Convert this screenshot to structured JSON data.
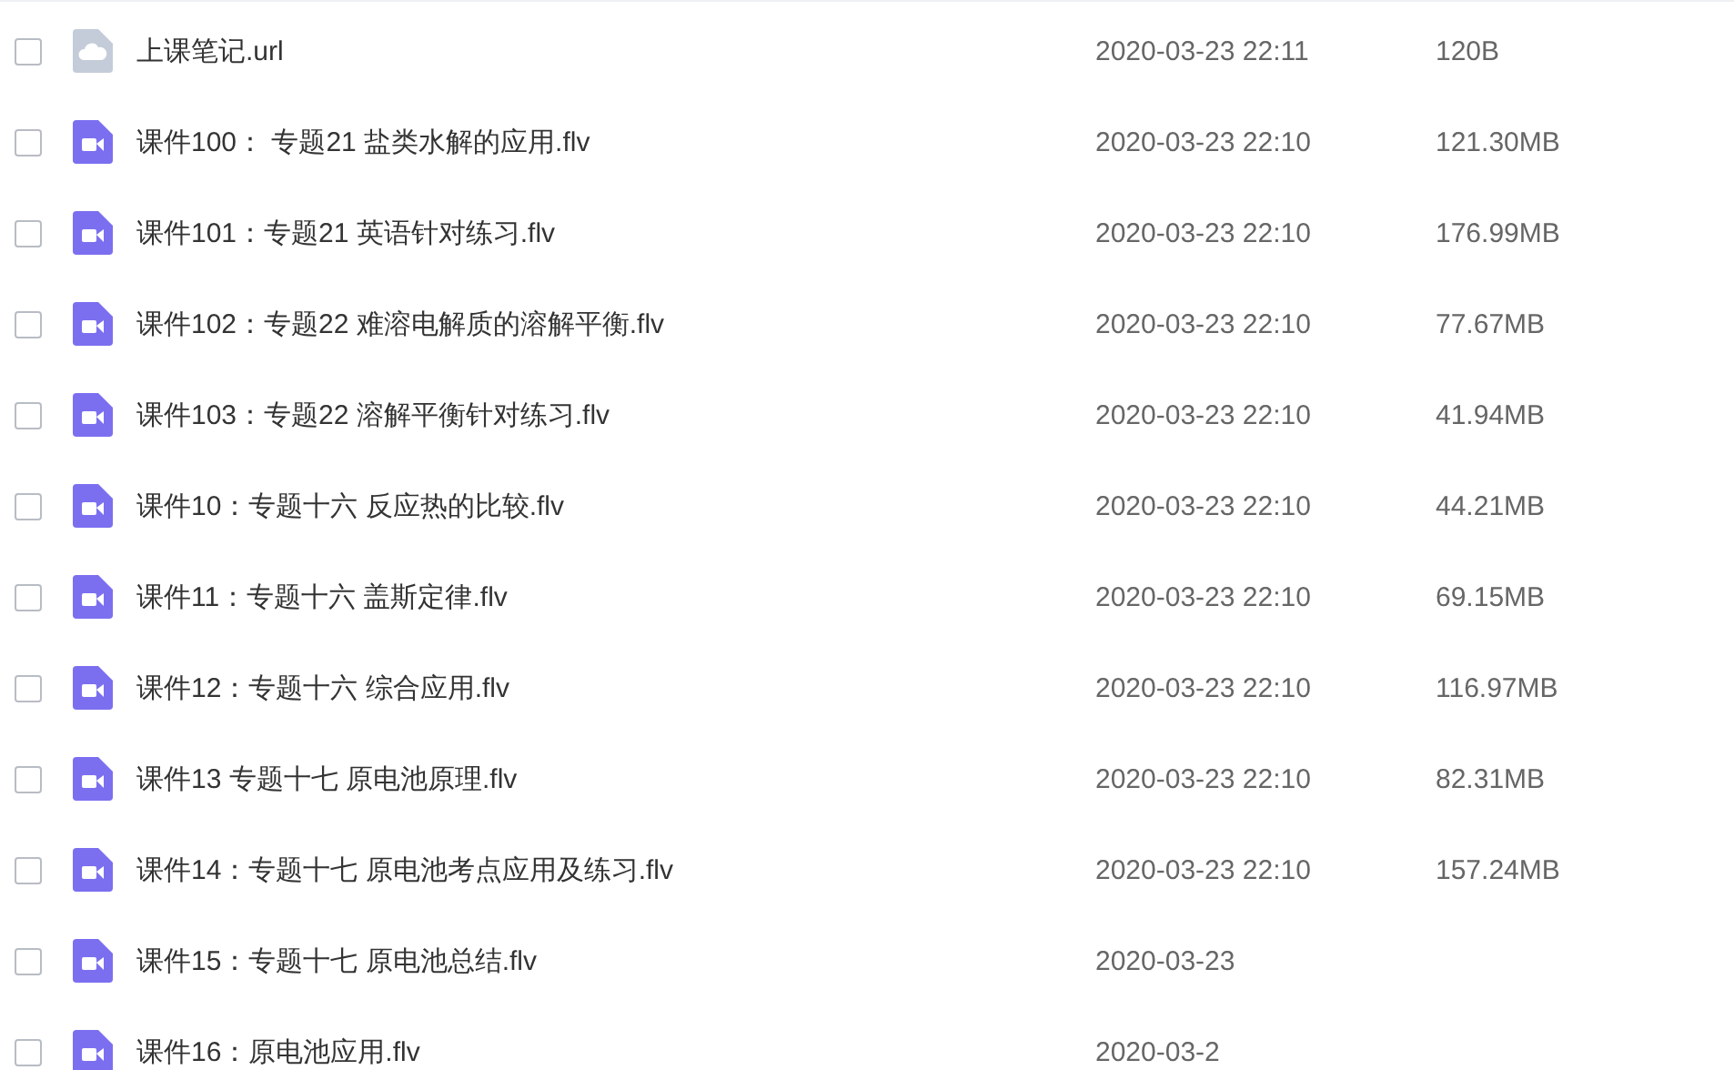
{
  "files": [
    {
      "kind": "link",
      "name": "上课笔记.url",
      "modified": "2020-03-23 22:11",
      "size": "120B",
      "checked": false
    },
    {
      "kind": "video",
      "name": "课件100：  专题21 盐类水解的应用.flv",
      "modified": "2020-03-23 22:10",
      "size": "121.30MB",
      "checked": false
    },
    {
      "kind": "video",
      "name": "课件101：专题21 英语针对练习.flv",
      "modified": "2020-03-23 22:10",
      "size": "176.99MB",
      "checked": false
    },
    {
      "kind": "video",
      "name": "课件102：专题22 难溶电解质的溶解平衡.flv",
      "modified": "2020-03-23 22:10",
      "size": "77.67MB",
      "checked": false
    },
    {
      "kind": "video",
      "name": "课件103：专题22 溶解平衡针对练习.flv",
      "modified": "2020-03-23 22:10",
      "size": "41.94MB",
      "checked": false
    },
    {
      "kind": "video",
      "name": "课件10：专题十六 反应热的比较.flv",
      "modified": "2020-03-23 22:10",
      "size": "44.21MB",
      "checked": false
    },
    {
      "kind": "video",
      "name": "课件11：专题十六 盖斯定律.flv",
      "modified": "2020-03-23 22:10",
      "size": "69.15MB",
      "checked": false
    },
    {
      "kind": "video",
      "name": "课件12：专题十六 综合应用.flv",
      "modified": "2020-03-23 22:10",
      "size": "116.97MB",
      "checked": false
    },
    {
      "kind": "video",
      "name": "课件13 专题十七 原电池原理.flv",
      "modified": "2020-03-23 22:10",
      "size": "82.31MB",
      "checked": false
    },
    {
      "kind": "video",
      "name": "课件14：专题十七 原电池考点应用及练习.flv",
      "modified": "2020-03-23 22:10",
      "size": "157.24MB",
      "checked": false
    },
    {
      "kind": "video",
      "name": "课件15：专题十七 原电池总结.flv",
      "modified": "2020-03-23",
      "checked": false
    },
    {
      "kind": "video",
      "name": "课件16：原电池应用.flv",
      "modified": "2020-03-2",
      "checked": false
    }
  ]
}
